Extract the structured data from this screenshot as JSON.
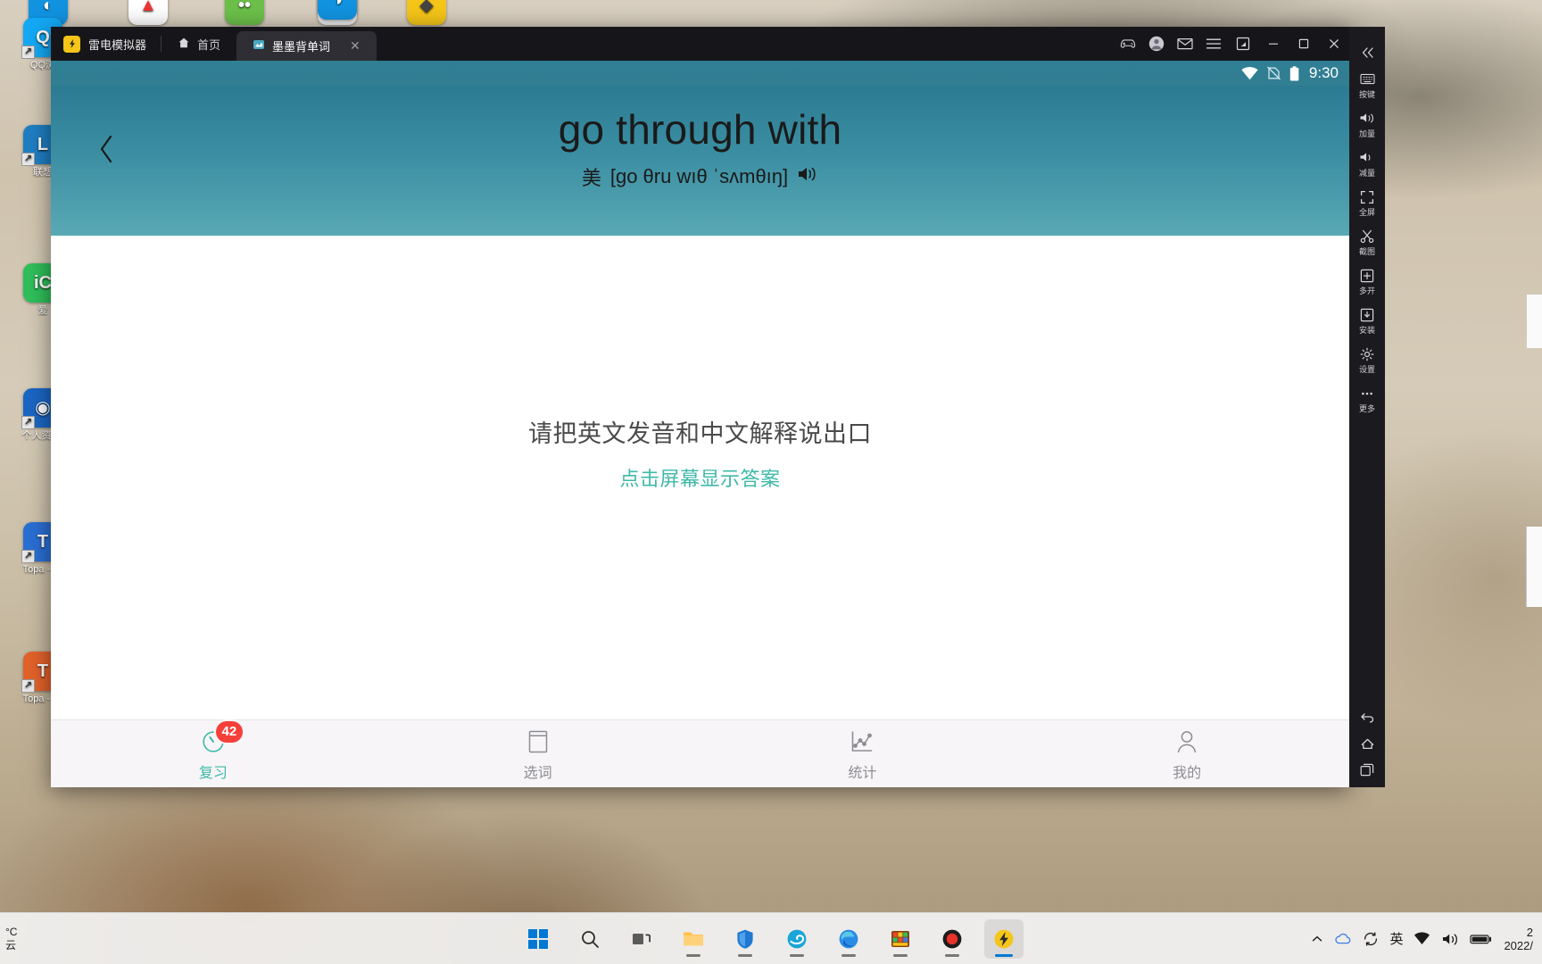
{
  "emulator": {
    "brand": "雷电模拟器",
    "brand_logo_glyph": "⚡",
    "tabs": [
      {
        "id": "home",
        "label": "首页",
        "icon": "home-icon",
        "active": false
      },
      {
        "id": "app",
        "label": "墨墨背单词",
        "icon": "app-icon",
        "active": true,
        "close_label": "✕"
      }
    ],
    "window_controls": [
      {
        "name": "gamepad-icon",
        "title": "游戏"
      },
      {
        "name": "account-icon",
        "title": "账号"
      },
      {
        "name": "mail-icon",
        "title": "消息"
      },
      {
        "name": "menu-icon",
        "title": "菜单"
      },
      {
        "name": "resize-icon",
        "title": "调整大小"
      },
      {
        "name": "minimize-icon",
        "title": "最小化"
      },
      {
        "name": "maximize-icon",
        "title": "最大化"
      },
      {
        "name": "close-icon",
        "title": "关闭"
      },
      {
        "name": "collapse-sidebar-icon",
        "title": "收起"
      }
    ],
    "sidebar": [
      {
        "id": "keymap",
        "label": "按键",
        "icon": "keyboard-icon"
      },
      {
        "id": "volume-up",
        "label": "加量",
        "icon": "volume-up-icon"
      },
      {
        "id": "volume-down",
        "label": "减量",
        "icon": "volume-down-icon"
      },
      {
        "id": "fullscreen",
        "label": "全屏",
        "icon": "fullscreen-icon"
      },
      {
        "id": "screenshot",
        "label": "截图",
        "icon": "scissors-icon"
      },
      {
        "id": "multi",
        "label": "多开",
        "icon": "multi-instance-icon"
      },
      {
        "id": "install",
        "label": "安装",
        "icon": "install-apk-icon"
      },
      {
        "id": "settings",
        "label": "设置",
        "icon": "gear-icon"
      },
      {
        "id": "more",
        "label": "更多",
        "icon": "more-icon"
      }
    ],
    "sidebar_bottom": [
      {
        "id": "back",
        "label": "",
        "icon": "android-back-icon"
      },
      {
        "id": "home",
        "label": "",
        "icon": "android-home-icon"
      },
      {
        "id": "recents",
        "label": "",
        "icon": "android-recents-icon"
      }
    ]
  },
  "android": {
    "statusbar": {
      "time": "9:30",
      "icons": [
        "wifi-icon",
        "no-sim-icon",
        "battery-full-icon"
      ]
    },
    "header": {
      "back_icon": "chevron-left-icon",
      "word": "go through with",
      "accent_label": "美",
      "phonetic": "[go θru wıθ ˈsʌmθıŋ]",
      "speaker_icon": "speaker-icon"
    },
    "card": {
      "prompt_main": "请把英文发音和中文解释说出口",
      "prompt_sub": "点击屏幕显示答案"
    },
    "bottom_nav": [
      {
        "id": "review",
        "label": "复习",
        "icon": "clock-review-icon",
        "badge": "42",
        "active": true
      },
      {
        "id": "select",
        "label": "选词",
        "icon": "book-icon",
        "badge": "",
        "active": false
      },
      {
        "id": "stats",
        "label": "统计",
        "icon": "chart-icon",
        "badge": "",
        "active": false
      },
      {
        "id": "mine",
        "label": "我的",
        "icon": "person-icon",
        "badge": "",
        "active": false
      }
    ]
  },
  "desktop": {
    "icons": [
      {
        "id": "qq",
        "label": "QQ浏",
        "glyph": "Q",
        "color": "#13a9f5"
      },
      {
        "id": "lenovo",
        "label": "联想",
        "glyph": "L",
        "color": "#1f7ec2"
      },
      {
        "id": "icloud",
        "label": "爱",
        "glyph": "iC",
        "color": "#2fbf5a"
      },
      {
        "id": "personal",
        "label": "个人资\n料",
        "glyph": "●",
        "color": "#1a66c4"
      },
      {
        "id": "topaz1",
        "label": "Topa\n- 快",
        "glyph": "T",
        "color": "#2a6fd4"
      },
      {
        "id": "topaz2",
        "label": "Topa\n- 快",
        "glyph": "T",
        "color": "#e2622a"
      }
    ],
    "top_icons": [
      {
        "id": "t1",
        "color": "#1193e0",
        "glyph": "◐"
      },
      {
        "id": "t2",
        "color": "#ffffff",
        "glyph": "▲"
      },
      {
        "id": "t3",
        "color": "#7ed321",
        "glyph": "••"
      },
      {
        "id": "t4",
        "color": "#f0f0f0",
        "glyph": "≡"
      },
      {
        "id": "t5",
        "color": "#1193e0",
        "glyph": "◑"
      },
      {
        "id": "t6",
        "color": "#f5c518",
        "glyph": "◆"
      }
    ]
  },
  "taskbar": {
    "weather": {
      "line1": "°C",
      "line2": "云"
    },
    "buttons": [
      {
        "id": "start",
        "name": "start-button",
        "icon": "windows-logo-icon"
      },
      {
        "id": "search",
        "name": "search-button",
        "icon": "search-icon"
      },
      {
        "id": "taskview",
        "name": "task-view-button",
        "icon": "task-view-icon"
      },
      {
        "id": "explorer",
        "name": "file-explorer-button",
        "icon": "folder-icon"
      },
      {
        "id": "security",
        "name": "security-app-button",
        "icon": "shield-icon"
      },
      {
        "id": "edge-old",
        "name": "browser-button",
        "icon": "edge-legacy-icon"
      },
      {
        "id": "edge",
        "name": "edge-button",
        "icon": "edge-icon"
      },
      {
        "id": "winrar",
        "name": "winrar-button",
        "icon": "archive-icon"
      },
      {
        "id": "recorder",
        "name": "recorder-button",
        "icon": "record-icon"
      },
      {
        "id": "ldplayer",
        "name": "ldplayer-taskbar-button",
        "icon": "ldplayer-icon"
      }
    ],
    "tray": [
      {
        "id": "chevron",
        "name": "show-hidden-icons",
        "glyph": "⌃"
      },
      {
        "id": "cloud",
        "name": "cloud-icon",
        "glyph": "☁"
      },
      {
        "id": "sync",
        "name": "sync-icon",
        "glyph": "⟳"
      },
      {
        "id": "ime",
        "name": "ime-indicator",
        "glyph": "英"
      },
      {
        "id": "wifi",
        "name": "wifi-icon",
        "glyph": ""
      },
      {
        "id": "volume",
        "name": "volume-icon",
        "glyph": ""
      },
      {
        "id": "battery",
        "name": "battery-icon",
        "glyph": ""
      }
    ],
    "clock": {
      "line1": "2",
      "line2": "2022/"
    }
  }
}
